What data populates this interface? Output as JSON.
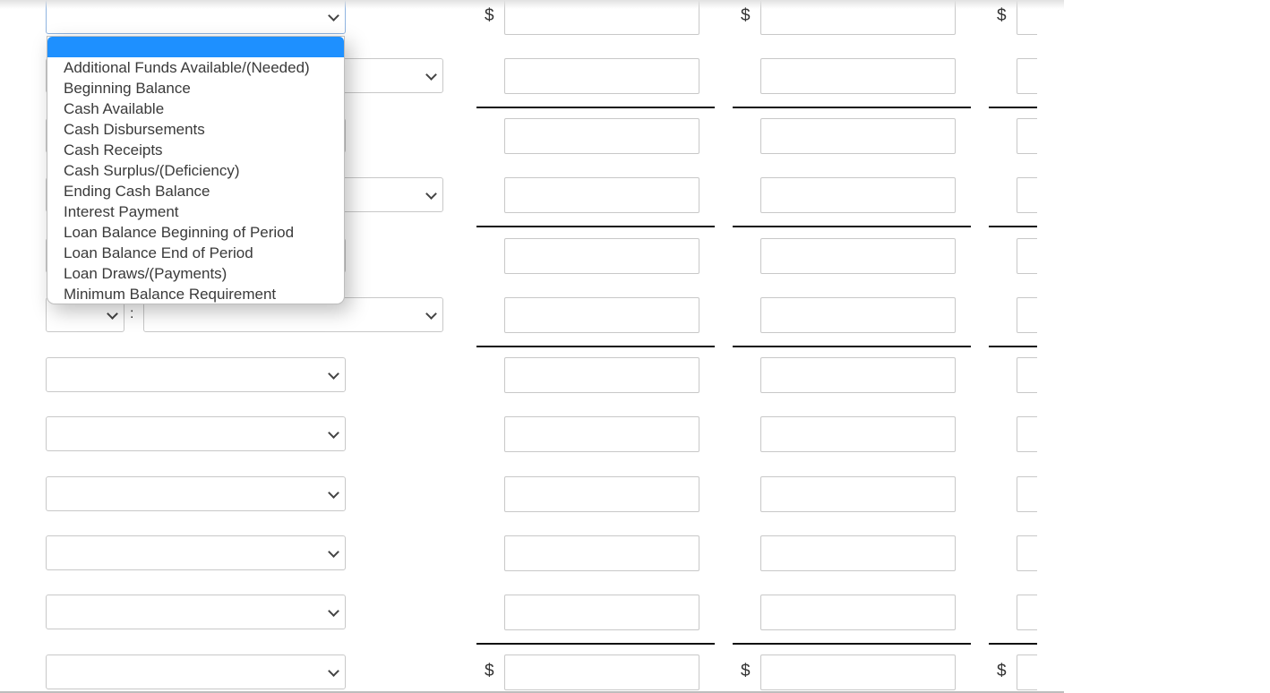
{
  "currency_symbol": "$",
  "dropdown": {
    "highlighted_option": "",
    "options": [
      "Additional Funds Available/(Needed)",
      "Beginning Balance",
      "Cash Available",
      "Cash Disbursements",
      "Cash Receipts",
      "Cash Surplus/(Deficiency)",
      "Ending Cash Balance",
      "Interest Payment",
      "Loan Balance Beginning of Period",
      "Loan Balance End of Period",
      "Loan Draws/(Payments)",
      "Minimum Balance Requirement"
    ]
  },
  "split_separator": ":",
  "rows": [
    {
      "label_select": "",
      "values": [
        "",
        "",
        ""
      ],
      "show_currency": true
    },
    {
      "label_select": "",
      "values": [
        "",
        "",
        ""
      ],
      "show_currency": false
    },
    {
      "label_select": "",
      "values": [
        "",
        "",
        ""
      ],
      "show_currency": false
    },
    {
      "label_select": "",
      "values": [
        "",
        "",
        ""
      ],
      "show_currency": false
    },
    {
      "label_select": "",
      "values": [
        "",
        "",
        ""
      ],
      "show_currency": false
    },
    {
      "label_select": "",
      "values": [
        "",
        "",
        ""
      ],
      "show_currency": false
    },
    {
      "label_select": "",
      "values": [
        "",
        "",
        ""
      ],
      "show_currency": false
    },
    {
      "label_select": "",
      "values": [
        "",
        "",
        ""
      ],
      "show_currency": false
    },
    {
      "label_select": "",
      "values": [
        "",
        "",
        ""
      ],
      "show_currency": false
    },
    {
      "label_select": "",
      "values": [
        "",
        "",
        ""
      ],
      "show_currency": false
    },
    {
      "label_select": "",
      "values": [
        "",
        "",
        ""
      ],
      "show_currency": false
    },
    {
      "label_select": "",
      "values": [
        "",
        "",
        ""
      ],
      "show_currency": true
    }
  ]
}
